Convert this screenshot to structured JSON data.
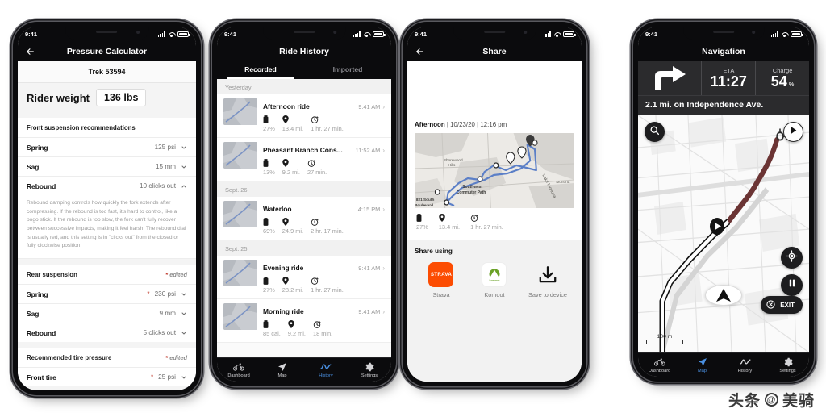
{
  "status_bar": {
    "time": "9:41",
    "signal_icon": "cellular-bars-icon",
    "wifi_icon": "wifi-icon",
    "battery_icon": "battery-icon"
  },
  "tab_bar": {
    "items": [
      {
        "label": "Dashboard",
        "icon": "bicycle-icon",
        "active": false
      },
      {
        "label": "Map",
        "icon": "navigation-arrow-icon",
        "active": false
      },
      {
        "label": "History",
        "icon": "activity-chart-icon",
        "active": true
      },
      {
        "label": "Settings",
        "icon": "gear-icon",
        "active": false
      }
    ]
  },
  "nav_tab_bar": {
    "items": [
      {
        "label": "Dashboard",
        "icon": "bicycle-icon",
        "active": false
      },
      {
        "label": "Map",
        "icon": "navigation-arrow-icon",
        "active": true
      },
      {
        "label": "History",
        "icon": "activity-chart-icon",
        "active": false
      },
      {
        "label": "Settings",
        "icon": "gear-icon",
        "active": false
      }
    ]
  },
  "pressure_calculator": {
    "title": "Pressure Calculator",
    "back_icon": "back-arrow-icon",
    "bike_name": "Trek 53594",
    "rider_weight_label": "Rider weight",
    "rider_weight_value": "136 lbs",
    "front": {
      "heading": "Front suspension recommendations",
      "rows": [
        {
          "label": "Spring",
          "value": "125 psi",
          "chevron": "chevron-down-icon",
          "edited": false
        },
        {
          "label": "Sag",
          "value": "15 mm",
          "chevron": "chevron-down-icon",
          "edited": false
        },
        {
          "label": "Rebound",
          "value": "10 clicks out",
          "chevron": "chevron-up-icon",
          "edited": false
        }
      ],
      "rebound_help": "Rebound damping controls how quickly the fork extends after compressing. If the rebound is too fast, it's hard to control, like a pogo stick. If the rebound is too slow, the fork can't fully recover between successive impacts, making it feel harsh. The rebound dial is usually red, and this setting is in \"clicks out\" from the closed or fully clockwise position."
    },
    "rear": {
      "heading": "Rear suspension",
      "edited_label": "edited",
      "edited_star": "*",
      "rows": [
        {
          "label": "Spring",
          "value": "230 psi",
          "chevron": "chevron-down-icon",
          "edited": true
        },
        {
          "label": "Sag",
          "value": "9 mm",
          "chevron": "chevron-down-icon",
          "edited": false
        },
        {
          "label": "Rebound",
          "value": "5 clicks out",
          "chevron": "chevron-down-icon",
          "edited": false
        }
      ]
    },
    "tire": {
      "heading": "Recommended tire pressure",
      "edited_label": "edited",
      "edited_star": "*",
      "rows": [
        {
          "label": "Front tire",
          "value": "25 psi",
          "chevron": "chevron-down-icon",
          "edited": true
        }
      ]
    }
  },
  "ride_history": {
    "title": "Ride History",
    "segments": [
      {
        "label": "Recorded",
        "active": true
      },
      {
        "label": "Imported",
        "active": false
      }
    ],
    "groups": [
      {
        "day": "Yesterday",
        "rides": [
          {
            "name": "Afternoon ride",
            "time": "9:41 AM",
            "battery": "27%",
            "distance": "13.4 mi.",
            "duration": "1 hr. 27 min.",
            "chevron": "chevron-right-icon"
          },
          {
            "name": "Pheasant Branch Cons...",
            "time": "11:52 AM",
            "battery": "13%",
            "distance": "9.2 mi.",
            "duration": "27 min.",
            "chevron": "chevron-right-icon"
          }
        ]
      },
      {
        "day": "Sept. 26",
        "rides": [
          {
            "name": "Waterloo",
            "time": "4:15 PM",
            "battery": "69%",
            "distance": "24.9 mi.",
            "duration": "2 hr. 17 min.",
            "chevron": "chevron-right-icon"
          }
        ]
      },
      {
        "day": "Sept. 25",
        "rides": [
          {
            "name": "Evening ride",
            "time": "9:41 AM",
            "battery": "27%",
            "distance": "28.2 mi.",
            "duration": "1 hr. 27 min.",
            "chevron": "chevron-right-icon"
          },
          {
            "name": "Morning ride",
            "time": "9:41 AM",
            "battery": "85 cal.",
            "distance": "9.2 mi.",
            "duration": "18 min.",
            "chevron": "chevron-right-icon"
          }
        ]
      }
    ],
    "stat_icons": {
      "battery": "battery-vertical-icon",
      "distance": "map-pin-icon",
      "duration": "stopwatch-icon"
    }
  },
  "share": {
    "title": "Share",
    "back_icon": "back-arrow-icon",
    "ride_name": "Afternoon",
    "ride_date": "10/23/20",
    "ride_clock": "12:16 pm",
    "separator": "|",
    "map_labels": [
      "Shorewood Hills",
      "Southwest Commuter Path",
      "821 South Boulevard",
      "Lake Monona",
      "Monona"
    ],
    "stats": {
      "battery": "27%",
      "distance": "13.4 mi.",
      "duration": "1 hr. 27 min."
    },
    "share_using_label": "Share using",
    "apps": [
      {
        "label": "Strava",
        "icon": "strava-icon",
        "color": "#FC4C02",
        "wordmark": "STRAVA"
      },
      {
        "label": "Komoot",
        "icon": "komoot-icon",
        "color": "#6AA127",
        "wordmark": "komoot"
      },
      {
        "label": "Save to device",
        "icon": "download-icon",
        "color": "#111111"
      }
    ]
  },
  "navigation": {
    "title": "Navigation",
    "turn_icon": "turn-right-icon",
    "eta_label": "ETA",
    "eta_value": "11:27",
    "charge_label": "Charge",
    "charge_value": "54",
    "charge_unit": "%",
    "instruction": "2.1 mi. on Independence Ave.",
    "search_icon": "search-icon",
    "compass_icon": "compass-arrow-icon",
    "locate_icon": "locate-target-icon",
    "pause_icon": "pause-icon",
    "exit_label": "EXIT",
    "exit_icon": "exit-circle-icon",
    "map_scale": "100 m",
    "route_color": "#6b3434",
    "rider_marker": "rider-position-arrow"
  },
  "watermark": {
    "text_left": "头条",
    "at": "@",
    "text_right": "美骑"
  }
}
